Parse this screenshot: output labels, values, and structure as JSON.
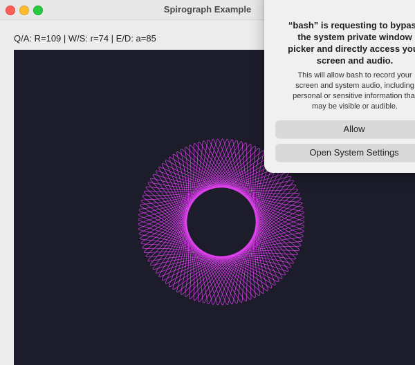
{
  "window": {
    "title": "Spirograph Example"
  },
  "status_line": "Q/A: R=109 | W/S: r=74 | E/D: a=85",
  "spirograph": {
    "R": 109,
    "r": 74,
    "a": 85,
    "stroke_color": "#e040f0",
    "background_color": "#1d1c2b"
  },
  "dialog": {
    "title": "“bash” is requesting to bypass\nthe system private window\npicker and directly access your\nscreen and audio.",
    "body": "This will allow bash to record your\nscreen and system audio, including\npersonal or sensitive information that\nmay be visible or audible.",
    "allow_label": "Allow",
    "settings_label": "Open System Settings"
  },
  "colors": {
    "accent_pink": "#e040f0",
    "canvas_bg": "#1d1c2b",
    "close": "#fe5f57",
    "minimize": "#febc2e",
    "maximize": "#28c840"
  }
}
